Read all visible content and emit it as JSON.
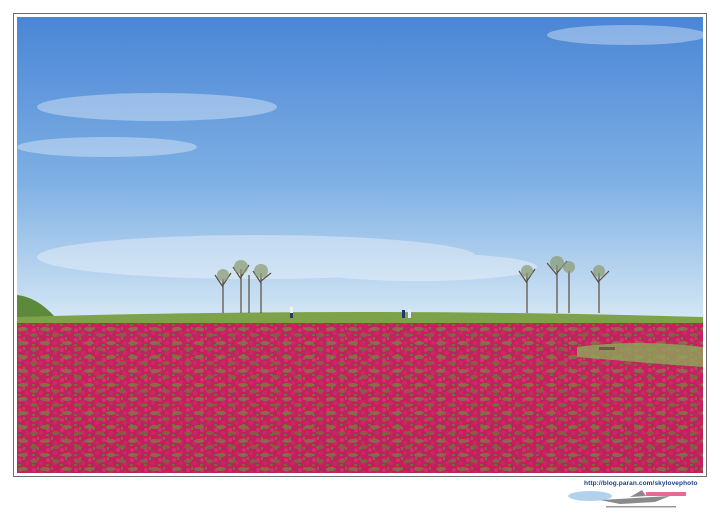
{
  "watermark": {
    "url": "http://blog.paran.com/skylovephoto",
    "logo_icon": "skylove-airplane-logo-icon"
  },
  "photo": {
    "subject": "pink-flower-field-with-trees-and-walkers",
    "colors": {
      "sky_top": "#4a86d6",
      "sky_horizon": "#cfe3f3",
      "grass": "#6e9a3c",
      "flowers": "#c2185b"
    }
  }
}
